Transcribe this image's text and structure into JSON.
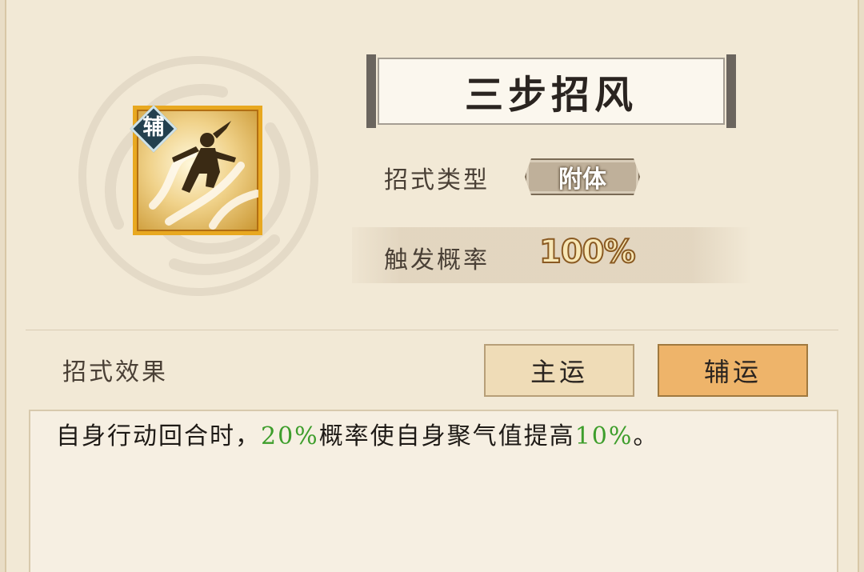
{
  "skill": {
    "name": "三步招风",
    "badge": "辅",
    "type_label": "招式类型",
    "type_value": "附体",
    "rate_label": "触发概率",
    "rate_value": "100%"
  },
  "effect": {
    "label": "招式效果",
    "buttons": {
      "main": "主运",
      "aux": "辅运"
    },
    "text_parts": [
      "自身行动回合时，",
      "20%",
      "概率使自身聚气值提高",
      "10%",
      "。"
    ]
  },
  "colors": {
    "highlight": "#3e9e2c",
    "aux_button": "#eeb46a",
    "main_button": "#efdcb7",
    "icon_border": "#e8a820"
  },
  "icons": {
    "badge": "diamond-badge",
    "skill": "wind-figure-icon",
    "background": "cloud-emblem"
  }
}
